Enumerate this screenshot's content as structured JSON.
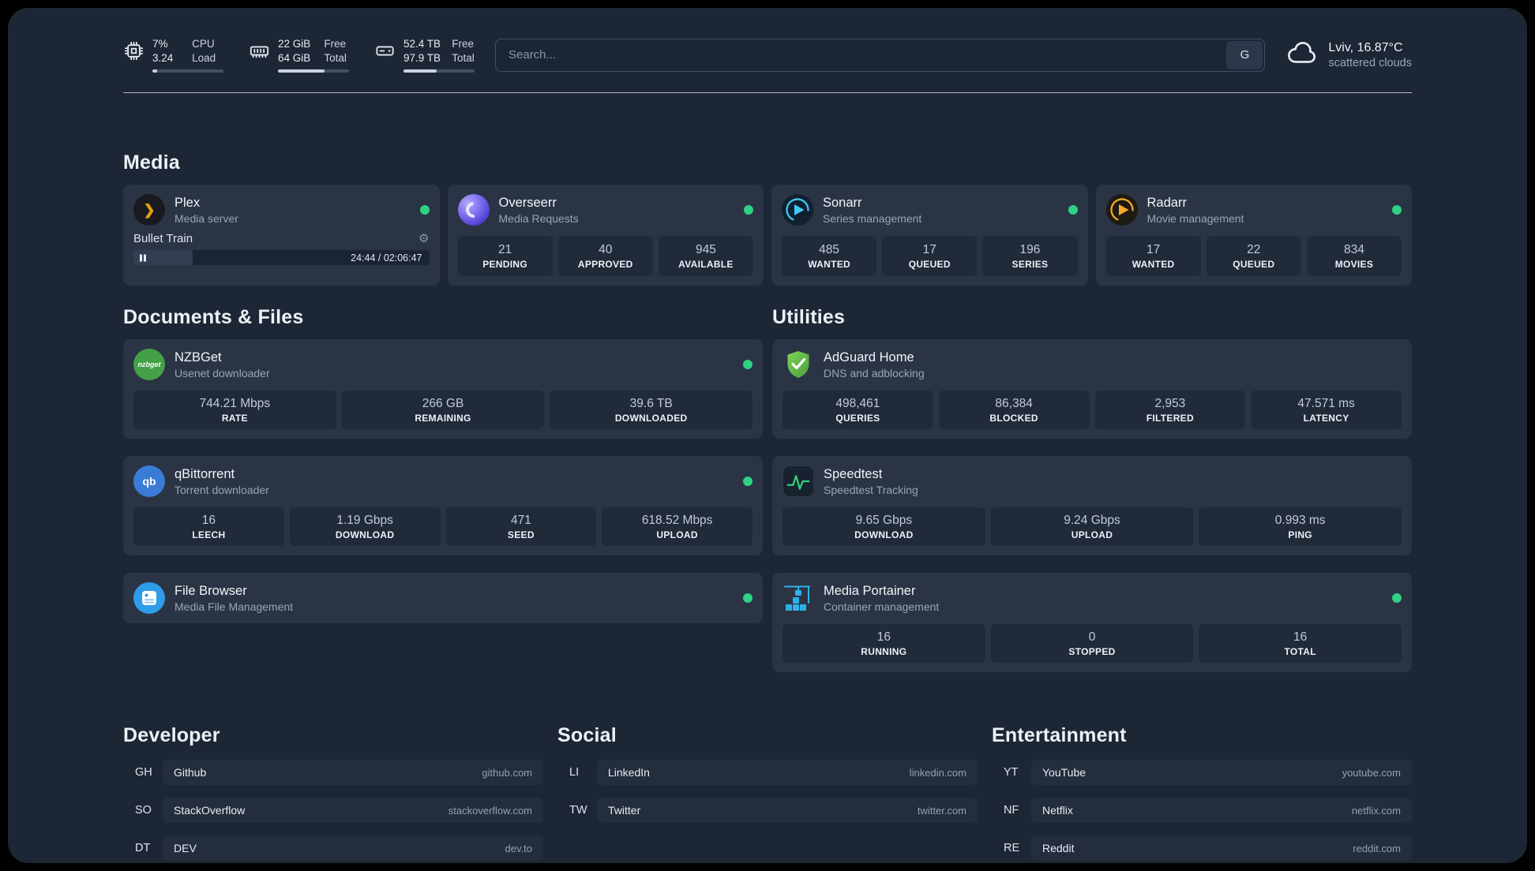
{
  "colors": {
    "status_online": "#2fd184",
    "accent_plex": "#e5a00d",
    "panel_bg": "#1d2634",
    "card_bg": "#2a3444"
  },
  "topbar": {
    "resources": [
      {
        "icon": "cpu-icon",
        "rows": [
          {
            "value": "7%",
            "label": "CPU"
          },
          {
            "value": "3.24",
            "label": "Load"
          }
        ],
        "progress": 7
      },
      {
        "icon": "memory-icon",
        "rows": [
          {
            "value": "22 GiB",
            "label": "Free"
          },
          {
            "value": "64 GiB",
            "label": "Total"
          }
        ],
        "progress": 66
      },
      {
        "icon": "disk-icon",
        "rows": [
          {
            "value": "52.4 TB",
            "label": "Free"
          },
          {
            "value": "97.9 TB",
            "label": "Total"
          }
        ],
        "progress": 47
      }
    ],
    "search": {
      "placeholder": "Search...",
      "provider_label": "G"
    },
    "weather": {
      "location": "Lviv, 16.87°C",
      "condition": "scattered clouds"
    }
  },
  "sections": {
    "media": {
      "title": "Media",
      "cards": [
        {
          "name": "Plex",
          "desc": "Media server",
          "status": "online",
          "player": {
            "title": "Bullet Train",
            "time": "24:44 / 02:06:47",
            "progress": 20
          }
        },
        {
          "name": "Overseerr",
          "desc": "Media Requests",
          "status": "online",
          "stats": [
            {
              "value": "21",
              "label": "PENDING"
            },
            {
              "value": "40",
              "label": "APPROVED"
            },
            {
              "value": "945",
              "label": "AVAILABLE"
            }
          ]
        },
        {
          "name": "Sonarr",
          "desc": "Series management",
          "status": "online",
          "stats": [
            {
              "value": "485",
              "label": "WANTED"
            },
            {
              "value": "17",
              "label": "QUEUED"
            },
            {
              "value": "196",
              "label": "SERIES"
            }
          ]
        },
        {
          "name": "Radarr",
          "desc": "Movie management",
          "status": "online",
          "stats": [
            {
              "value": "17",
              "label": "WANTED"
            },
            {
              "value": "22",
              "label": "QUEUED"
            },
            {
              "value": "834",
              "label": "MOVIES"
            }
          ]
        }
      ]
    },
    "documents": {
      "title": "Documents & Files",
      "cards": [
        {
          "name": "NZBGet",
          "desc": "Usenet downloader",
          "status": "online",
          "stats": [
            {
              "value": "744.21 Mbps",
              "label": "RATE"
            },
            {
              "value": "266 GB",
              "label": "REMAINING"
            },
            {
              "value": "39.6 TB",
              "label": "DOWNLOADED"
            }
          ]
        },
        {
          "name": "qBittorrent",
          "desc": "Torrent downloader",
          "status": "online",
          "stats": [
            {
              "value": "16",
              "label": "LEECH"
            },
            {
              "value": "1.19 Gbps",
              "label": "DOWNLOAD"
            },
            {
              "value": "471",
              "label": "SEED"
            },
            {
              "value": "618.52 Mbps",
              "label": "UPLOAD"
            }
          ]
        },
        {
          "name": "File Browser",
          "desc": "Media File Management",
          "status": "online",
          "stats": []
        }
      ]
    },
    "utilities": {
      "title": "Utilities",
      "cards": [
        {
          "name": "AdGuard Home",
          "desc": "DNS and adblocking",
          "stats": [
            {
              "value": "498,461",
              "label": "QUERIES"
            },
            {
              "value": "86,384",
              "label": "BLOCKED"
            },
            {
              "value": "2,953",
              "label": "FILTERED"
            },
            {
              "value": "47.571 ms",
              "label": "LATENCY"
            }
          ]
        },
        {
          "name": "Speedtest",
          "desc": "Speedtest Tracking",
          "stats": [
            {
              "value": "9.65 Gbps",
              "label": "DOWNLOAD"
            },
            {
              "value": "9.24 Gbps",
              "label": "UPLOAD"
            },
            {
              "value": "0.993 ms",
              "label": "PING"
            }
          ]
        },
        {
          "name": "Media Portainer",
          "desc": "Container management",
          "status": "online",
          "stats": [
            {
              "value": "16",
              "label": "RUNNING"
            },
            {
              "value": "0",
              "label": "STOPPED"
            },
            {
              "value": "16",
              "label": "TOTAL"
            }
          ]
        }
      ]
    },
    "bookmarks": [
      {
        "title": "Developer",
        "items": [
          {
            "abbr": "GH",
            "name": "Github",
            "domain": "github.com"
          },
          {
            "abbr": "SO",
            "name": "StackOverflow",
            "domain": "stackoverflow.com"
          },
          {
            "abbr": "DT",
            "name": "DEV",
            "domain": "dev.to"
          }
        ]
      },
      {
        "title": "Social",
        "items": [
          {
            "abbr": "LI",
            "name": "LinkedIn",
            "domain": "linkedin.com"
          },
          {
            "abbr": "TW",
            "name": "Twitter",
            "domain": "twitter.com"
          }
        ]
      },
      {
        "title": "Entertainment",
        "items": [
          {
            "abbr": "YT",
            "name": "YouTube",
            "domain": "youtube.com"
          },
          {
            "abbr": "NF",
            "name": "Netflix",
            "domain": "netflix.com"
          },
          {
            "abbr": "RE",
            "name": "Reddit",
            "domain": "reddit.com"
          }
        ]
      }
    ]
  }
}
